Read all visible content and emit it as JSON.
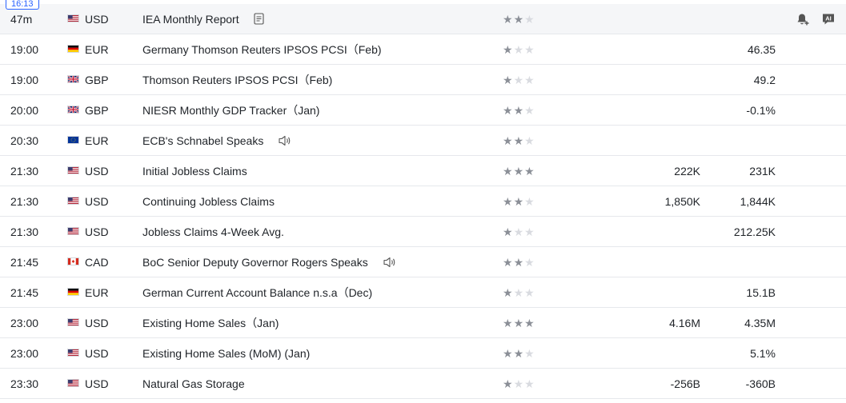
{
  "now_time": "16:13",
  "colors": {
    "accent": "#2962ff",
    "star_on": "#8b8f97",
    "star_off": "#d9dbe0"
  },
  "header_tools": {
    "alert_icon": "bell-plus-icon",
    "ai_label": "AI"
  },
  "rows": [
    {
      "time": "47m",
      "flag": "us",
      "currency": "USD",
      "event": "IEA Monthly Report",
      "icon": "document-icon",
      "stars": 2,
      "actual": "",
      "forecast": ""
    },
    {
      "time": "19:00",
      "flag": "de",
      "currency": "EUR",
      "event": "Germany Thomson Reuters IPSOS PCSI（Feb)",
      "icon": "",
      "stars": 1,
      "actual": "",
      "forecast": "46.35"
    },
    {
      "time": "19:00",
      "flag": "gb",
      "currency": "GBP",
      "event": "Thomson Reuters IPSOS PCSI（Feb)",
      "icon": "",
      "stars": 1,
      "actual": "",
      "forecast": "49.2"
    },
    {
      "time": "20:00",
      "flag": "gb",
      "currency": "GBP",
      "event": "NIESR Monthly GDP Tracker（Jan)",
      "icon": "",
      "stars": 2,
      "actual": "",
      "forecast": "-0.1%"
    },
    {
      "time": "20:30",
      "flag": "eu",
      "currency": "EUR",
      "event": "ECB's Schnabel Speaks",
      "icon": "speaker-icon",
      "stars": 2,
      "actual": "",
      "forecast": ""
    },
    {
      "time": "21:30",
      "flag": "us",
      "currency": "USD",
      "event": "Initial Jobless Claims",
      "icon": "",
      "stars": 3,
      "actual": "222K",
      "forecast": "231K"
    },
    {
      "time": "21:30",
      "flag": "us",
      "currency": "USD",
      "event": "Continuing Jobless Claims",
      "icon": "",
      "stars": 2,
      "actual": "1,850K",
      "forecast": "1,844K"
    },
    {
      "time": "21:30",
      "flag": "us",
      "currency": "USD",
      "event": "Jobless Claims 4-Week Avg.",
      "icon": "",
      "stars": 1,
      "actual": "",
      "forecast": "212.25K"
    },
    {
      "time": "21:45",
      "flag": "ca",
      "currency": "CAD",
      "event": "BoC Senior Deputy Governor Rogers Speaks",
      "icon": "speaker-icon",
      "stars": 2,
      "actual": "",
      "forecast": ""
    },
    {
      "time": "21:45",
      "flag": "de",
      "currency": "EUR",
      "event": "German Current Account Balance n.s.a（Dec)",
      "icon": "",
      "stars": 1,
      "actual": "",
      "forecast": "15.1B"
    },
    {
      "time": "23:00",
      "flag": "us",
      "currency": "USD",
      "event": "Existing Home Sales（Jan)",
      "icon": "",
      "stars": 3,
      "actual": "4.16M",
      "forecast": "4.35M"
    },
    {
      "time": "23:00",
      "flag": "us",
      "currency": "USD",
      "event": "Existing Home Sales (MoM) (Jan)",
      "icon": "",
      "stars": 2,
      "actual": "",
      "forecast": "5.1%"
    },
    {
      "time": "23:30",
      "flag": "us",
      "currency": "USD",
      "event": "Natural Gas Storage",
      "icon": "",
      "stars": 1,
      "actual": "-256B",
      "forecast": "-360B"
    }
  ]
}
